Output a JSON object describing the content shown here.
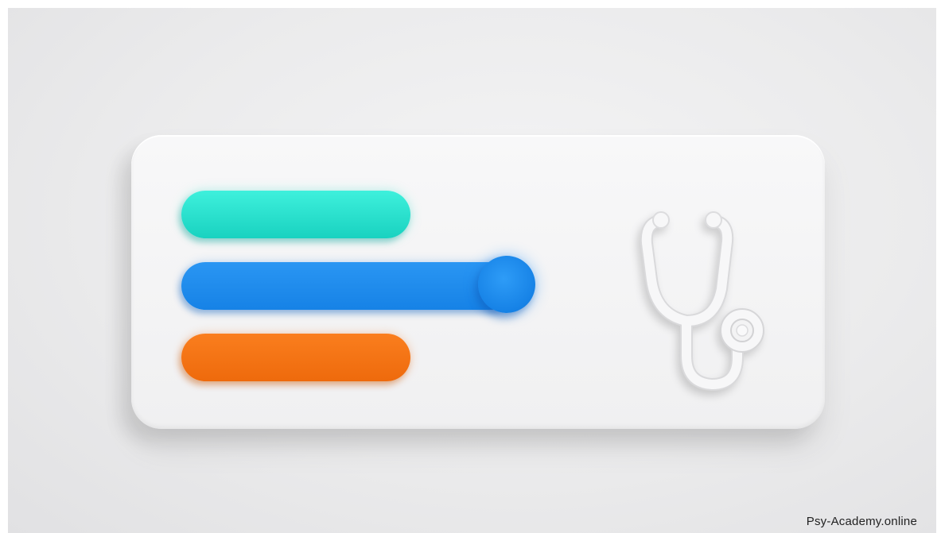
{
  "watermark": {
    "text": "Psy-Academy.online"
  },
  "panel": {
    "bars": [
      {
        "name": "teal-bar",
        "color": "#1fdcc8"
      },
      {
        "name": "blue-slider",
        "color": "#1a88ea"
      },
      {
        "name": "orange-bar",
        "color": "#f37312"
      }
    ],
    "icon": "stethoscope-icon"
  },
  "colors": {
    "background": "#ebebec",
    "card": "#f4f4f5",
    "icon": "#f7f7f8"
  }
}
